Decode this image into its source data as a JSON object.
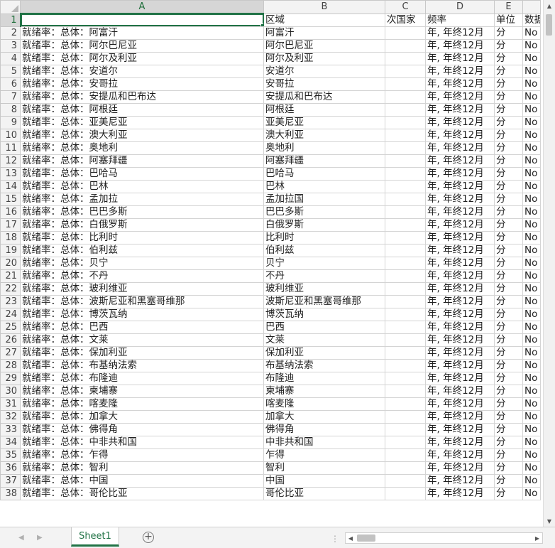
{
  "columns": [
    "A",
    "B",
    "C",
    "D",
    "E",
    ""
  ],
  "header_row": {
    "row": "1",
    "a": "",
    "b": "区域",
    "c": "次国家",
    "d": "频率",
    "e": "单位",
    "f": "数据"
  },
  "common": {
    "prefix": "就绪率：总体：",
    "freq": "年, 年终12月",
    "unit": "分",
    "f_val": "No"
  },
  "rows": [
    {
      "n": "2",
      "a": "阿富汗",
      "b": "阿富汗"
    },
    {
      "n": "3",
      "a": "阿尔巴尼亚",
      "b": "阿尔巴尼亚"
    },
    {
      "n": "4",
      "a": "阿尔及利亚",
      "b": "阿尔及利亚"
    },
    {
      "n": "5",
      "a": "安道尔",
      "b": "安道尔"
    },
    {
      "n": "6",
      "a": "安哥拉",
      "b": "安哥拉"
    },
    {
      "n": "7",
      "a": "安提瓜和巴布达",
      "b": "安提瓜和巴布达"
    },
    {
      "n": "8",
      "a": "阿根廷",
      "b": "阿根廷"
    },
    {
      "n": "9",
      "a": "亚美尼亚",
      "b": "亚美尼亚"
    },
    {
      "n": "10",
      "a": "澳大利亚",
      "b": "澳大利亚"
    },
    {
      "n": "11",
      "a": "奥地利",
      "b": "奥地利"
    },
    {
      "n": "12",
      "a": "阿塞拜疆",
      "b": "阿塞拜疆"
    },
    {
      "n": "13",
      "a": "巴哈马",
      "b": "巴哈马"
    },
    {
      "n": "14",
      "a": "巴林",
      "b": "巴林"
    },
    {
      "n": "15",
      "a": "孟加拉",
      "b": "孟加拉国"
    },
    {
      "n": "16",
      "a": "巴巴多斯",
      "b": "巴巴多斯"
    },
    {
      "n": "17",
      "a": "白俄罗斯",
      "b": "白俄罗斯"
    },
    {
      "n": "18",
      "a": "比利时",
      "b": "比利时"
    },
    {
      "n": "19",
      "a": "伯利兹",
      "b": "伯利兹"
    },
    {
      "n": "20",
      "a": "贝宁",
      "b": "贝宁"
    },
    {
      "n": "21",
      "a": "不丹",
      "b": "不丹"
    },
    {
      "n": "22",
      "a": "玻利维亚",
      "b": "玻利维亚"
    },
    {
      "n": "23",
      "a": "波斯尼亚和黑塞哥维那",
      "b": "波斯尼亚和黑塞哥维那"
    },
    {
      "n": "24",
      "a": "博茨瓦纳",
      "b": "博茨瓦纳"
    },
    {
      "n": "25",
      "a": "巴西",
      "b": "巴西"
    },
    {
      "n": "26",
      "a": "文莱",
      "b": "文莱"
    },
    {
      "n": "27",
      "a": "保加利亚",
      "b": "保加利亚"
    },
    {
      "n": "28",
      "a": "布基纳法索",
      "b": "布基纳法索"
    },
    {
      "n": "29",
      "a": "布隆迪",
      "b": "布隆迪"
    },
    {
      "n": "30",
      "a": "柬埔寨",
      "b": "柬埔寨"
    },
    {
      "n": "31",
      "a": "喀麦隆",
      "b": "喀麦隆"
    },
    {
      "n": "32",
      "a": "加拿大",
      "b": "加拿大"
    },
    {
      "n": "33",
      "a": "佛得角",
      "b": "佛得角"
    },
    {
      "n": "34",
      "a": "中非共和国",
      "b": "中非共和国"
    },
    {
      "n": "35",
      "a": "乍得",
      "b": "乍得"
    },
    {
      "n": "36",
      "a": "智利",
      "b": "智利"
    },
    {
      "n": "37",
      "a": "中国",
      "b": "中国"
    },
    {
      "n": "38",
      "a": "哥伦比亚",
      "b": "哥伦比亚"
    }
  ],
  "sheet_tab": "Sheet1",
  "icons": {
    "add_sheet": "plus-circle-icon",
    "scroll_up": "triangle-up-icon",
    "scroll_down": "triangle-down-icon"
  },
  "colors": {
    "accent": "#217346",
    "header_bg": "#f3f3f3",
    "gridline": "#d4d4d4"
  }
}
